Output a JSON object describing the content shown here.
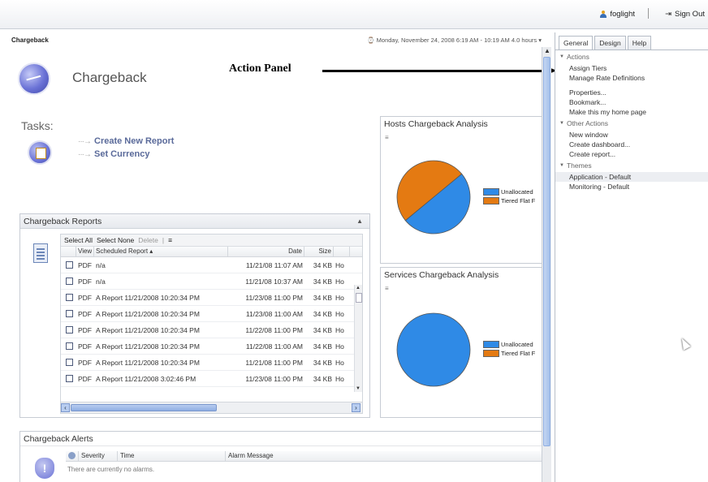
{
  "topbar": {
    "user": "foglight",
    "sign_out": "Sign Out"
  },
  "header": {
    "title": "Chargeback",
    "time_range": "Monday, November 24, 2008 6:19 AM - 10:19 AM 4.0 hours"
  },
  "hero": {
    "title": "Chargeback"
  },
  "annotation": {
    "label": "Action Panel"
  },
  "tasks": {
    "label": "Tasks:",
    "items": [
      "Create New Report",
      "Set Currency"
    ]
  },
  "reports": {
    "title": "Chargeback Reports",
    "toolbar": {
      "select_all": "Select All",
      "select_none": "Select None",
      "delete": "Delete"
    },
    "columns": {
      "view": "View",
      "name": "Scheduled Report",
      "date": "Date",
      "size": "Size"
    },
    "rows": [
      {
        "view": "PDF",
        "name": "n/a",
        "date": "11/21/08 11:07 AM",
        "size": "34 KB",
        "more": "Ho"
      },
      {
        "view": "PDF",
        "name": "n/a",
        "date": "11/21/08 10:37 AM",
        "size": "34 KB",
        "more": "Ho"
      },
      {
        "view": "PDF",
        "name": "A Report 11/21/2008 10:20:34 PM",
        "date": "11/23/08 11:00 PM",
        "size": "34 KB",
        "more": "Ho"
      },
      {
        "view": "PDF",
        "name": "A Report 11/21/2008 10:20:34 PM",
        "date": "11/23/08 11:00 AM",
        "size": "34 KB",
        "more": "Ho"
      },
      {
        "view": "PDF",
        "name": "A Report 11/21/2008 10:20:34 PM",
        "date": "11/22/08 11:00 PM",
        "size": "34 KB",
        "more": "Ho"
      },
      {
        "view": "PDF",
        "name": "A Report 11/21/2008 10:20:34 PM",
        "date": "11/22/08 11:00 AM",
        "size": "34 KB",
        "more": "Ho"
      },
      {
        "view": "PDF",
        "name": "A Report 11/21/2008 10:20:34 PM",
        "date": "11/21/08 11:00 PM",
        "size": "34 KB",
        "more": "Ho"
      },
      {
        "view": "PDF",
        "name": "A Report 11/21/2008 3:02:46 PM",
        "date": "11/23/08 11:00 PM",
        "size": "34 KB",
        "more": "Ho"
      }
    ]
  },
  "hosts_chart": {
    "title": "Hosts Chargeback Analysis"
  },
  "services_chart": {
    "title": "Services Chargeback Analysis"
  },
  "chart_data": [
    {
      "type": "pie",
      "title": "Hosts Chargeback Analysis",
      "labels": [
        "Unallocated",
        "Tiered Flat F"
      ],
      "values": [
        50,
        50
      ],
      "colors": [
        "#2f8ae6",
        "#e47a12"
      ]
    },
    {
      "type": "pie",
      "title": "Services Chargeback Analysis",
      "labels": [
        "Unallocated",
        "Tiered Flat F"
      ],
      "values": [
        100,
        0
      ],
      "colors": [
        "#2f8ae6",
        "#e47a12"
      ]
    }
  ],
  "alerts": {
    "title": "Chargeback Alerts",
    "columns": {
      "severity": "Severity",
      "time": "Time",
      "message": "Alarm Message"
    },
    "empty_text": "There are currently no alarms."
  },
  "side_panel": {
    "tabs": [
      "General",
      "Design",
      "Help"
    ],
    "sections": {
      "actions": {
        "title": "Actions",
        "items": [
          "Assign Tiers",
          "Manage Rate Definitions",
          "Properties...",
          "Bookmark...",
          "Make this my home page"
        ]
      },
      "other_actions": {
        "title": "Other Actions",
        "items": [
          "New window",
          "Create dashboard...",
          "Create report..."
        ]
      },
      "themes": {
        "title": "Themes",
        "items": [
          "Application - Default",
          "Monitoring - Default"
        ]
      }
    }
  },
  "colors": {
    "accent": "#5a6a9a",
    "pie_blue": "#2f8ae6",
    "pie_orange": "#e47a12",
    "scroll_blue": "#8eaee2"
  }
}
